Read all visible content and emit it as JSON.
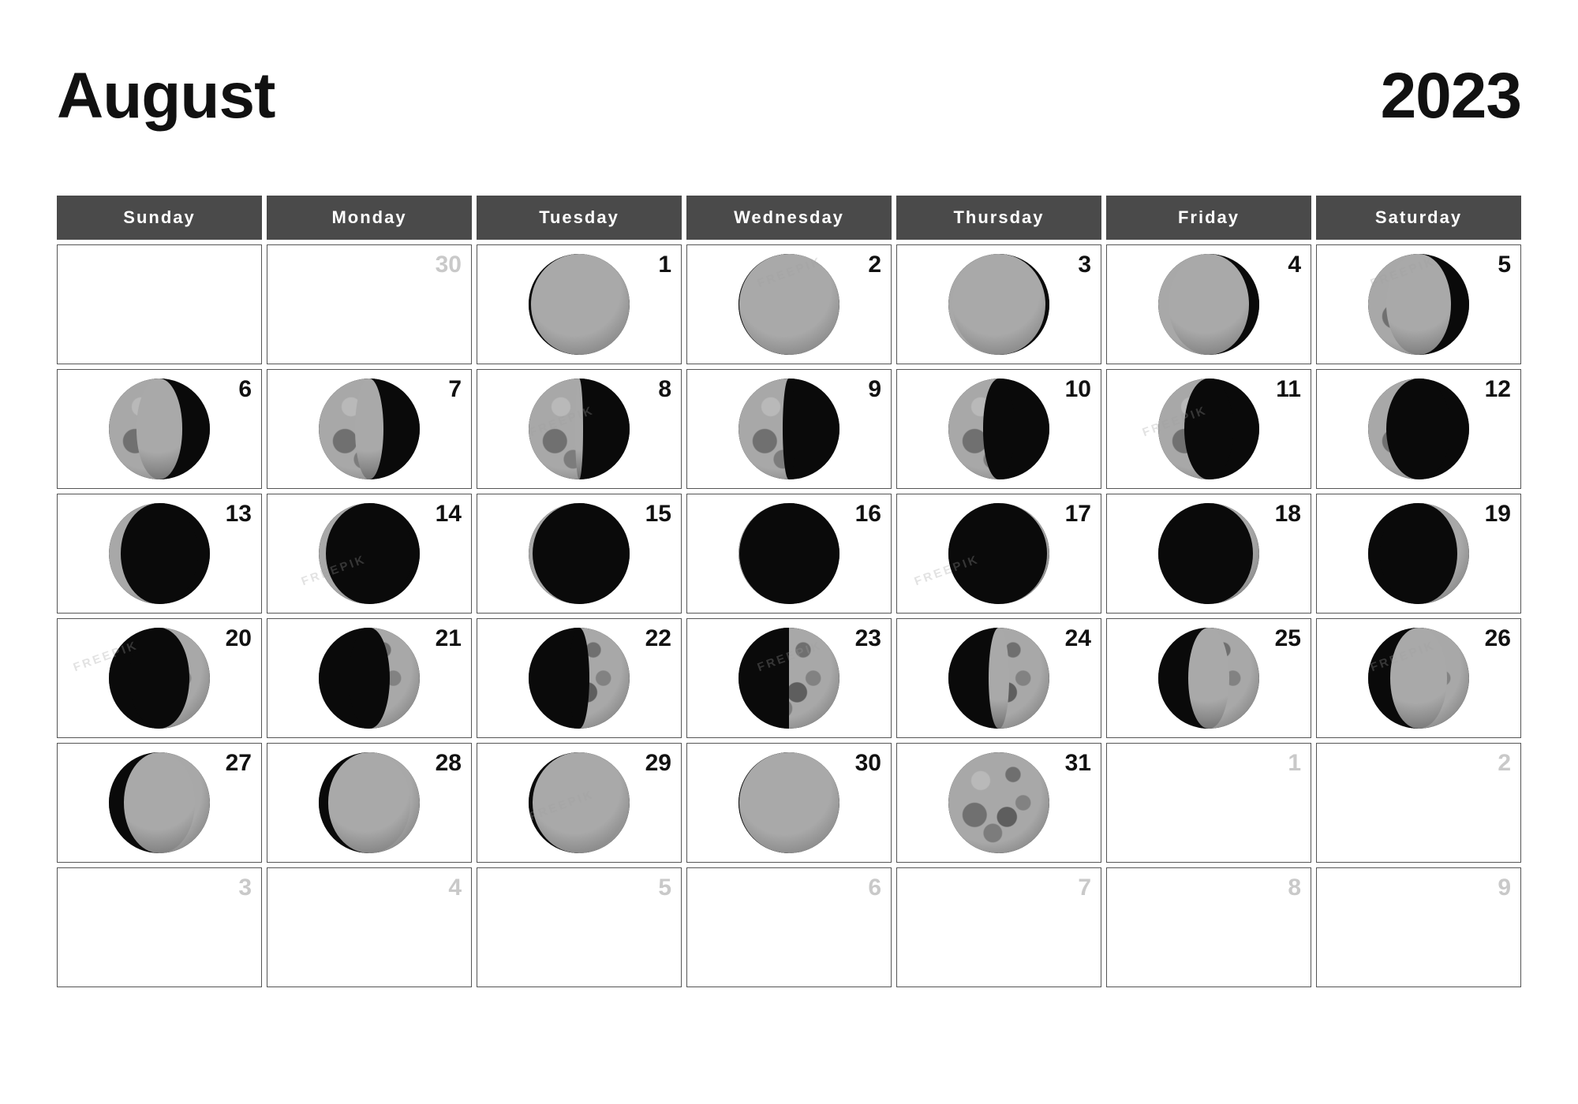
{
  "header": {
    "month": "August",
    "year": "2023"
  },
  "weekdays": [
    "Sunday",
    "Monday",
    "Tuesday",
    "Wednesday",
    "Thursday",
    "Friday",
    "Saturday"
  ],
  "colors": {
    "header_band": "#4a4a4a",
    "header_band_text": "#ffffff",
    "day_number": "#111111",
    "adjacent_day_number": "#c9c9c9",
    "cell_border": "#555555",
    "background": "#ffffff"
  },
  "watermark": {
    "text": "FREEPIK"
  },
  "weeks": [
    [
      {
        "num": "",
        "current": false,
        "moon": null
      },
      {
        "num": "30",
        "current": false,
        "moon": null
      },
      {
        "num": "1",
        "current": true,
        "moon": {
          "phase": "waxing-gibbous",
          "illum": 98,
          "lit": "right"
        }
      },
      {
        "num": "2",
        "current": true,
        "moon": {
          "phase": "full-moon",
          "illum": 99,
          "lit": "right"
        }
      },
      {
        "num": "3",
        "current": true,
        "moon": {
          "phase": "waning-gibbous",
          "illum": 96,
          "lit": "left"
        }
      },
      {
        "num": "4",
        "current": true,
        "moon": {
          "phase": "waning-gibbous",
          "illum": 90,
          "lit": "left"
        }
      },
      {
        "num": "5",
        "current": true,
        "moon": {
          "phase": "waning-gibbous",
          "illum": 82,
          "lit": "left"
        }
      }
    ],
    [
      {
        "num": "6",
        "current": true,
        "moon": {
          "phase": "waning-gibbous",
          "illum": 73,
          "lit": "left"
        }
      },
      {
        "num": "7",
        "current": true,
        "moon": {
          "phase": "waning-gibbous",
          "illum": 64,
          "lit": "left"
        }
      },
      {
        "num": "8",
        "current": true,
        "moon": {
          "phase": "last-quarter",
          "illum": 54,
          "lit": "left"
        }
      },
      {
        "num": "9",
        "current": true,
        "moon": {
          "phase": "waning-crescent",
          "illum": 44,
          "lit": "left"
        }
      },
      {
        "num": "10",
        "current": true,
        "moon": {
          "phase": "waning-crescent",
          "illum": 34,
          "lit": "left"
        }
      },
      {
        "num": "11",
        "current": true,
        "moon": {
          "phase": "waning-crescent",
          "illum": 26,
          "lit": "left"
        }
      },
      {
        "num": "12",
        "current": true,
        "moon": {
          "phase": "waning-crescent",
          "illum": 18,
          "lit": "left"
        }
      }
    ],
    [
      {
        "num": "13",
        "current": true,
        "moon": {
          "phase": "waning-crescent",
          "illum": 12,
          "lit": "left"
        }
      },
      {
        "num": "14",
        "current": true,
        "moon": {
          "phase": "waning-crescent",
          "illum": 7,
          "lit": "left"
        }
      },
      {
        "num": "15",
        "current": true,
        "moon": {
          "phase": "waning-crescent",
          "illum": 4,
          "lit": "left"
        }
      },
      {
        "num": "16",
        "current": true,
        "moon": {
          "phase": "new-moon",
          "illum": 1,
          "lit": "left"
        }
      },
      {
        "num": "17",
        "current": true,
        "moon": {
          "phase": "new-moon",
          "illum": 2,
          "lit": "right"
        }
      },
      {
        "num": "18",
        "current": true,
        "moon": {
          "phase": "waxing-crescent",
          "illum": 6,
          "lit": "right"
        }
      },
      {
        "num": "19",
        "current": true,
        "moon": {
          "phase": "waxing-crescent",
          "illum": 12,
          "lit": "right"
        }
      }
    ],
    [
      {
        "num": "20",
        "current": true,
        "moon": {
          "phase": "waxing-crescent",
          "illum": 20,
          "lit": "right"
        }
      },
      {
        "num": "21",
        "current": true,
        "moon": {
          "phase": "waxing-crescent",
          "illum": 30,
          "lit": "right"
        }
      },
      {
        "num": "22",
        "current": true,
        "moon": {
          "phase": "waxing-crescent",
          "illum": 40,
          "lit": "right"
        }
      },
      {
        "num": "23",
        "current": true,
        "moon": {
          "phase": "first-quarter",
          "illum": 50,
          "lit": "right"
        }
      },
      {
        "num": "24",
        "current": true,
        "moon": {
          "phase": "first-quarter",
          "illum": 60,
          "lit": "right"
        }
      },
      {
        "num": "25",
        "current": true,
        "moon": {
          "phase": "waxing-gibbous",
          "illum": 70,
          "lit": "right"
        }
      },
      {
        "num": "26",
        "current": true,
        "moon": {
          "phase": "waxing-gibbous",
          "illum": 78,
          "lit": "right"
        }
      }
    ],
    [
      {
        "num": "27",
        "current": true,
        "moon": {
          "phase": "waxing-gibbous",
          "illum": 85,
          "lit": "right"
        }
      },
      {
        "num": "28",
        "current": true,
        "moon": {
          "phase": "waxing-gibbous",
          "illum": 91,
          "lit": "right"
        }
      },
      {
        "num": "29",
        "current": true,
        "moon": {
          "phase": "waxing-gibbous",
          "illum": 96,
          "lit": "right"
        }
      },
      {
        "num": "30",
        "current": true,
        "moon": {
          "phase": "full-moon",
          "illum": 99,
          "lit": "right"
        }
      },
      {
        "num": "31",
        "current": true,
        "moon": {
          "phase": "full-moon",
          "illum": 100,
          "lit": "right"
        }
      },
      {
        "num": "1",
        "current": false,
        "moon": null
      },
      {
        "num": "2",
        "current": false,
        "moon": null
      }
    ],
    [
      {
        "num": "3",
        "current": false,
        "moon": null
      },
      {
        "num": "4",
        "current": false,
        "moon": null
      },
      {
        "num": "5",
        "current": false,
        "moon": null
      },
      {
        "num": "6",
        "current": false,
        "moon": null
      },
      {
        "num": "7",
        "current": false,
        "moon": null
      },
      {
        "num": "8",
        "current": false,
        "moon": null
      },
      {
        "num": "9",
        "current": false,
        "moon": null
      }
    ]
  ]
}
